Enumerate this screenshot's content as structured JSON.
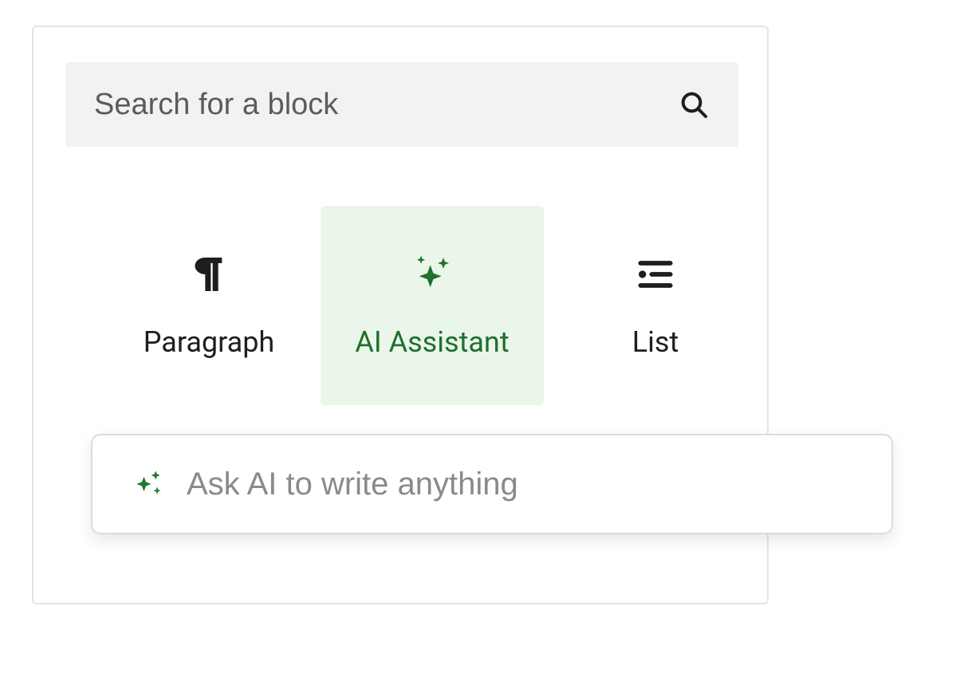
{
  "search": {
    "placeholder": "Search for a block"
  },
  "blocks": {
    "paragraph": {
      "label": "Paragraph"
    },
    "ai_assistant": {
      "label": "AI Assistant"
    },
    "list": {
      "label": "List"
    }
  },
  "ai_prompt": {
    "placeholder": "Ask AI to write anything"
  },
  "colors": {
    "highlight_bg": "#eaf6ea",
    "highlight_fg": "#1f6f2e"
  }
}
